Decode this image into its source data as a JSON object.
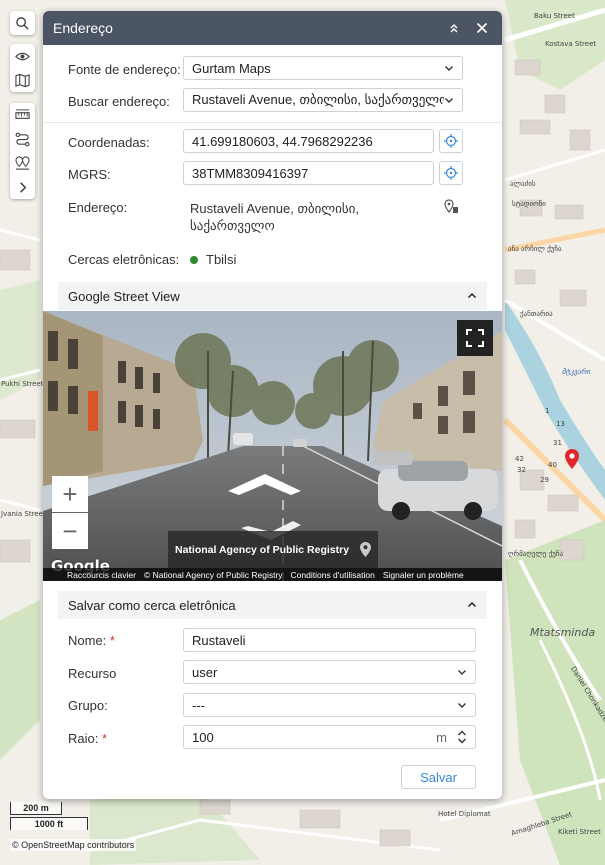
{
  "map": {
    "labels": [
      "Baku Street",
      "Kostava Street",
      "ალაძის",
      "სტადიონი",
      "ანა არჩილ ქუჩა",
      "ქანთარია",
      "Pukhi Street",
      "Jvania Street",
      "მტკვარი",
      "Mtatsminda",
      "Daniel Chonkadze Street",
      "Amaghleba Street",
      "Hotel Diplomat",
      "ღრმაღელე ქუჩა",
      "Kiketi Street"
    ],
    "house_numbers": [
      "31",
      "40",
      "42",
      "29",
      "32",
      "13",
      "1"
    ],
    "scale_metric": "200 m",
    "scale_imperial": "1000 ft",
    "attribution": "© OpenStreetMap contributors"
  },
  "toolbar": {
    "icons": [
      "search-icon",
      "eye-icon",
      "map-icon",
      "ruler-icon",
      "route-icon",
      "geofence-icon",
      "expand-icon"
    ]
  },
  "panel": {
    "title": "Endereço",
    "address_source": {
      "label": "Fonte de endereço:",
      "value": "Gurtam Maps"
    },
    "search_address": {
      "label": "Buscar endereço:",
      "value": "Rustaveli Avenue, თბილისი, საქართველო"
    },
    "coordinates": {
      "label": "Coordenadas:",
      "value": "41.699180603, 44.7968292236"
    },
    "mgrs": {
      "label": "MGRS:",
      "value": "38TMM8309416397"
    },
    "address": {
      "label": "Endereço:",
      "value_line1": "Rustaveli Avenue, თბილისი,",
      "value_line2": "საქართველო"
    },
    "geofences": {
      "label": "Cercas eletrônicas:",
      "value": "Tbilsi",
      "color": "#2e8b2e"
    }
  },
  "street_view": {
    "section_title": "Google Street View",
    "zoom_in": "+",
    "zoom_out": "−",
    "provider": "National Agency of Public Registry",
    "logo": "Google",
    "footer": [
      "Raccourcis clavier",
      "© National Agency of Public Registry",
      "Conditions d'utilisation",
      "Signaler un problème"
    ]
  },
  "geofence_form": {
    "section_title": "Salvar como cerca eletrônica",
    "name": {
      "label": "Nome:",
      "required": "*",
      "value": "Rustaveli"
    },
    "resource": {
      "label": "Recurso",
      "value": "user"
    },
    "group": {
      "label": "Grupo:",
      "value": "---"
    },
    "radius": {
      "label": "Raio:",
      "required": "*",
      "value": "100",
      "unit": "m"
    },
    "save_label": "Salvar"
  },
  "colors": {
    "header": "#4b5564",
    "accent": "#3a86d6",
    "pin": "#e3262b"
  }
}
